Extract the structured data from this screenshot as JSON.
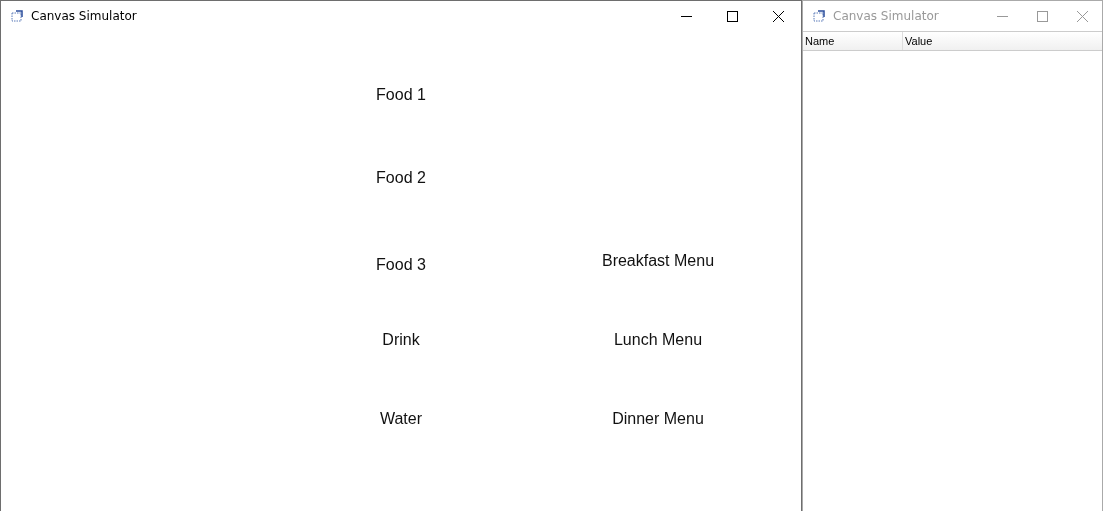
{
  "windows": [
    {
      "title": "Canvas Simulator",
      "active": true,
      "canvas": {
        "labels": [
          {
            "text": "Food 1"
          },
          {
            "text": "Food 2"
          },
          {
            "text": "Food 3"
          },
          {
            "text": "Drink"
          },
          {
            "text": "Water"
          },
          {
            "text": "Breakfast Menu"
          },
          {
            "text": "Lunch Menu"
          },
          {
            "text": "Dinner Menu"
          }
        ]
      }
    },
    {
      "title": "Canvas Simulator",
      "active": false,
      "table": {
        "columns": [
          "Name",
          "Value"
        ]
      }
    }
  ]
}
